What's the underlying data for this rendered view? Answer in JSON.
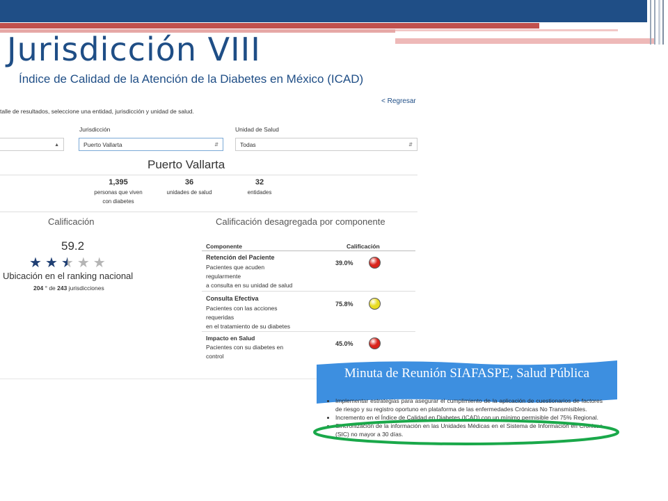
{
  "slide": {
    "title": "Jurisdicción VIII",
    "subtitle": "Índice de Calidad de la Atención de la Diabetes en México (ICAD)"
  },
  "web": {
    "back_link": "< Regresar",
    "instructions": "talle de resultados, seleccione una entidad, jurisdicción y unidad de salud.",
    "filters": {
      "jurisdiccion_label": "Jurisdicción",
      "jurisdiccion_value": "Puerto Vallarta",
      "unidad_label": "Unidad de Salud",
      "unidad_value": "Todas"
    },
    "heading": "Puerto Vallarta",
    "stats": [
      {
        "value": "1,395",
        "label1": "personas que viven",
        "label2": "con diabetes"
      },
      {
        "value": "36",
        "label1": "unidades de salud",
        "label2": ""
      },
      {
        "value": "32",
        "label1": "entidades",
        "label2": ""
      }
    ],
    "calificacion": {
      "heading": "Calificación",
      "score": "59.2",
      "stars_rating": 2.5,
      "stars_max": 5,
      "ranking_title": "Ubicación en el ranking nacional",
      "rank": "204",
      "rank_sep": "° de",
      "rank_total": "243",
      "rank_suffix": "jurisdicciones"
    },
    "components": {
      "heading": "Calificación desagregada por componente",
      "col_component": "Componente",
      "col_score": "Calificación",
      "rows": [
        {
          "name": "Retención del Paciente",
          "desc": [
            "Pacientes que acuden",
            "regularmente",
            "a consulta en su unidad de salud"
          ],
          "value": "39.0%",
          "color": "#d9241c"
        },
        {
          "name": "Consulta Efectiva",
          "desc": [
            "Pacientes con las acciones",
            "requeridas",
            "en el tratamiento de su diabetes"
          ],
          "value": "75.8%",
          "color": "#e8dc22"
        },
        {
          "name": "Impacto en Salud",
          "desc": [
            "Pacientes con su diabetes en",
            "control"
          ],
          "value": "45.0%",
          "color": "#d9241c"
        }
      ]
    }
  },
  "banner": {
    "text": "Minuta de Reunión SIAFASPE, Salud Pública",
    "color": "#3d8fe0"
  },
  "minutes": {
    "items": [
      "Implementar estrategias para asegurar el cumplimiento de la aplicación de cuestionarios de factores de riesgo y su registro oportuno en plataforma de las enfermedades Crónicas No Transmisibles.",
      "Incremento en el Índice de Calidad en Diabetes (ICAD) con un mínimo permisible del 75% Regional.",
      "Sincronización de la información en las Unidades Médicas en el Sistema de Información en Crónicas (SIC) no mayor a 30 días."
    ],
    "highlight_color": "#1aa84a"
  }
}
